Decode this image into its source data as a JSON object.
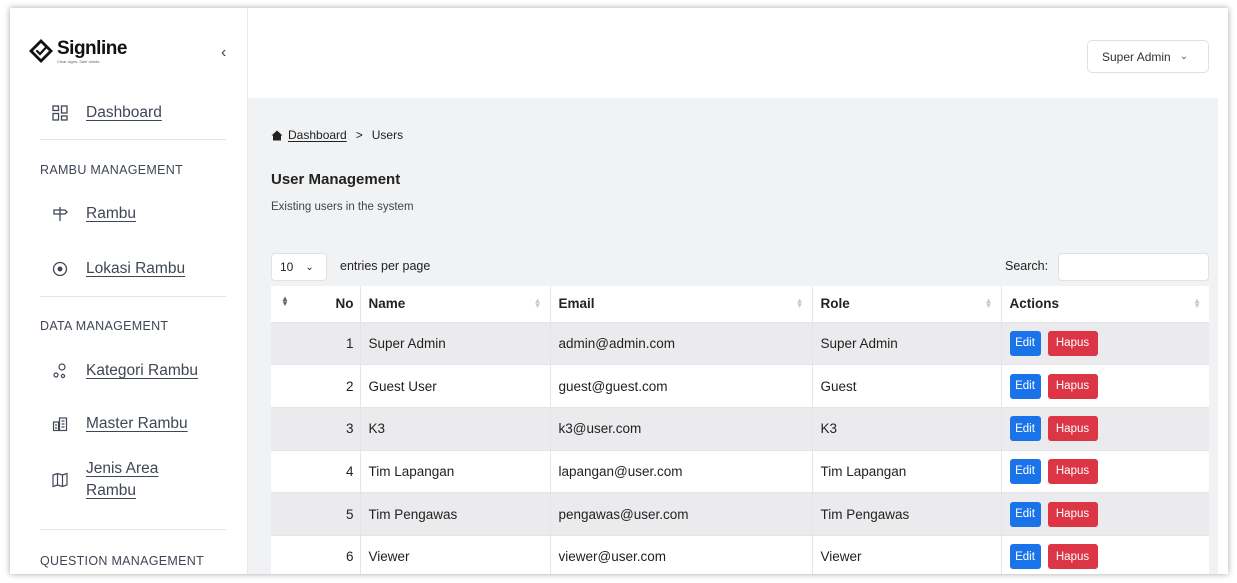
{
  "brand": {
    "name": "Signline",
    "tagline": "Clear signs. Safe minds."
  },
  "sidebar": {
    "collapse_icon": "chevron-left-icon",
    "dashboard": {
      "label": "Dashboard",
      "icon": "grid-icon"
    },
    "sections": [
      {
        "title": "RAMBU MANAGEMENT",
        "items": [
          {
            "label": "Rambu",
            "icon": "signpost-icon"
          },
          {
            "label": "Lokasi Rambu",
            "icon": "location-icon"
          }
        ]
      },
      {
        "title": "DATA MANAGEMENT",
        "items": [
          {
            "label": "Kategori Rambu",
            "icon": "category-icon"
          },
          {
            "label": "Master Rambu",
            "icon": "building-icon"
          },
          {
            "label": "Jenis Area Rambu",
            "icon": "map-icon"
          }
        ]
      },
      {
        "title": "QUESTION MANAGEMENT",
        "items": []
      }
    ]
  },
  "topbar": {
    "user_label": "Super Admin"
  },
  "breadcrumb": {
    "home": "Dashboard",
    "separator": ">",
    "current": "Users"
  },
  "page": {
    "title": "User Management",
    "subtitle": "Existing users in the system"
  },
  "table_controls": {
    "page_length": "10",
    "length_label": "entries per page",
    "search_label": "Search:",
    "search_value": ""
  },
  "table": {
    "columns": [
      "No",
      "Name",
      "Email",
      "Role",
      "Actions"
    ],
    "edit_label": "Edit",
    "delete_label": "Hapus",
    "rows": [
      {
        "no": "1",
        "name": "Super Admin",
        "email": "admin@admin.com",
        "role": "Super Admin"
      },
      {
        "no": "2",
        "name": "Guest User",
        "email": "guest@guest.com",
        "role": "Guest"
      },
      {
        "no": "3",
        "name": "K3",
        "email": "k3@user.com",
        "role": "K3"
      },
      {
        "no": "4",
        "name": "Tim Lapangan",
        "email": "lapangan@user.com",
        "role": "Tim Lapangan"
      },
      {
        "no": "5",
        "name": "Tim Pengawas",
        "email": "pengawas@user.com",
        "role": "Tim Pengawas"
      },
      {
        "no": "6",
        "name": "Viewer",
        "email": "viewer@user.com",
        "role": "Viewer"
      }
    ]
  },
  "colors": {
    "edit": "#1a73e8",
    "delete": "#dc3545",
    "content_bg": "#f1f2f4"
  }
}
